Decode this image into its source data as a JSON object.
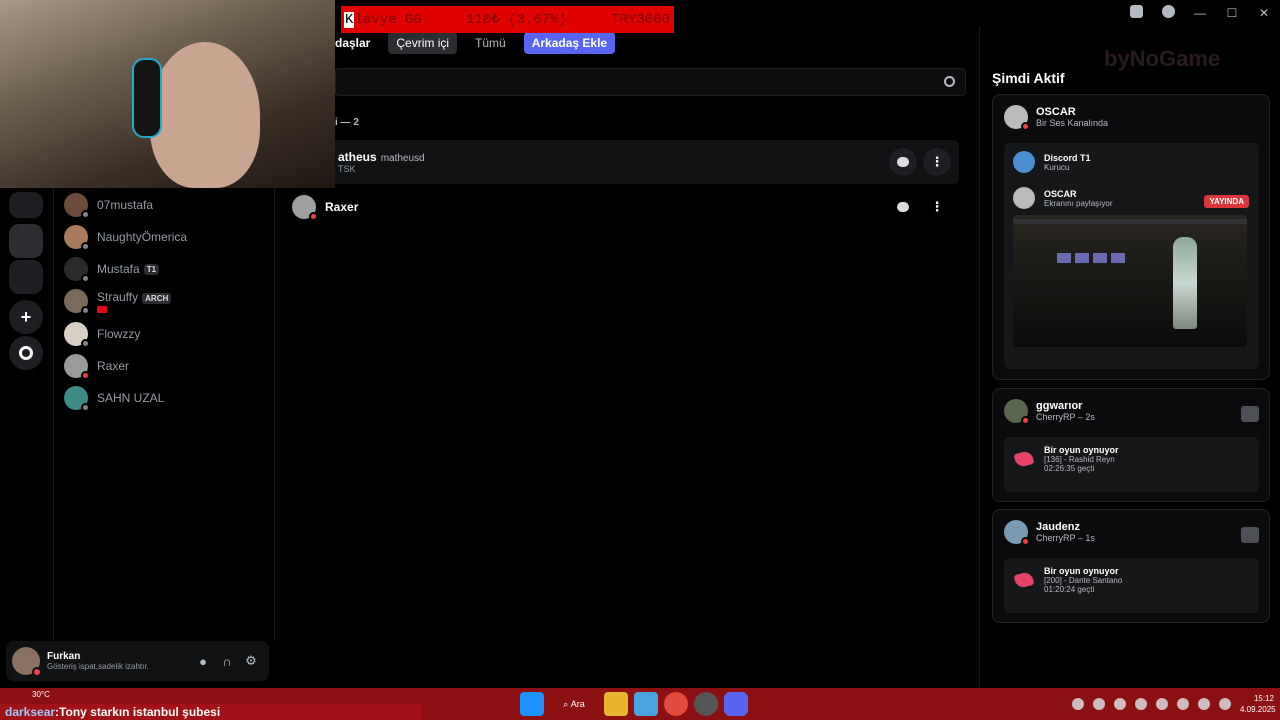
{
  "overlay": {
    "ticker_k": "K",
    "ticker_label": "lavye GG",
    "ticker_amount": "110₺ (3.67%)",
    "ticker_goal": "TRY3000",
    "watermark": "byNoGame"
  },
  "main": {
    "tabs": [
      {
        "label": "daşlar"
      },
      {
        "label": "Çevrim içi"
      },
      {
        "label": "Tümü"
      },
      {
        "label": "Arkadaş Ekle"
      }
    ],
    "search": {
      "value": ""
    },
    "section_header": "i — 2",
    "friends": [
      {
        "name": "atheus",
        "tag": "matheusd",
        "sub": "TSK"
      },
      {
        "name": "Raxer",
        "tag": "",
        "sub": ""
      }
    ]
  },
  "dm_list": [
    {
      "name": "07mustafa",
      "status_color": "#80848e"
    },
    {
      "name": "NaughtyÖmerica",
      "status_color": "#80848e"
    },
    {
      "name": "Mustafa",
      "badge": "T1",
      "status_color": "#80848e"
    },
    {
      "name": "Strauffy",
      "badge": "ARCH",
      "status_color": "#80848e"
    },
    {
      "name": "Flowzzy",
      "status_color": "#80848e"
    },
    {
      "name": "Raxer",
      "status_color": "#f23f43"
    },
    {
      "name": "SAHN UZAL",
      "status_color": "#80848e"
    }
  ],
  "user_panel": {
    "name": "Furkan",
    "status": "Gösteriş ispat,sadelik izahtır."
  },
  "active_now": {
    "title": "Şimdi Aktif",
    "cards": [
      {
        "name": "OSCAR",
        "sub": "Bir Ses Kanalında",
        "server": {
          "name": "Discord T1",
          "role": "Kurucu"
        },
        "streamer": {
          "name": "OSCAR",
          "activity": "Ekranını paylaşıyor",
          "live": "YAYINDA"
        }
      },
      {
        "name": "ggwarıor",
        "sub": "CherryRP – 2s",
        "game": {
          "title": "Bir oyun oynuyor",
          "detail": "[136] - Rashid Reyn",
          "elapsed": "02:26:35 geçti"
        }
      },
      {
        "name": "Jaudenz",
        "sub": "CherryRP – 1s",
        "game": {
          "title": "Bir oyun oynuyor",
          "detail": "[200] - Dante Santano",
          "elapsed": "01:20:24 geçti"
        }
      }
    ]
  },
  "taskbar": {
    "weather": "30°C",
    "marquee_user": "darksear",
    "marquee_text": ":Tony starkın istanbul şubesi",
    "search": "Ara",
    "time": "15:12",
    "date": "4.09.2025"
  },
  "colors": {
    "accent": "#5865f2",
    "live": "#da373c",
    "dnd": "#f23f43",
    "taskbar": "#8c0f12"
  }
}
